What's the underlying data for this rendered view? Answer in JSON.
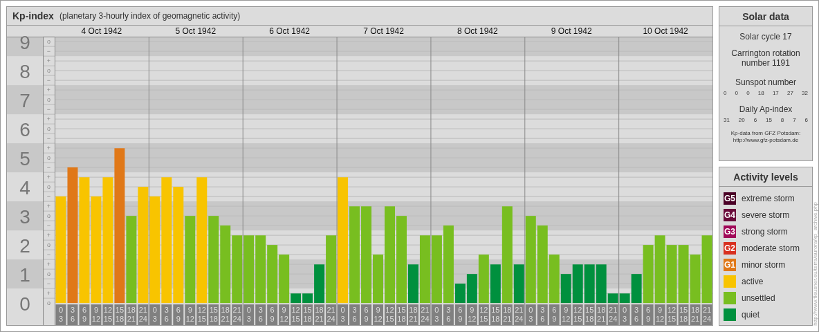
{
  "kp_panel": {
    "title": "Kp-index",
    "subtitle": "(planetary 3-hourly index of geomagnetic activity)",
    "days": [
      {
        "date": "4 Oct 1942"
      },
      {
        "date": "5 Oct 1942"
      },
      {
        "date": "6 Oct 1942"
      },
      {
        "date": "7 Oct 1942"
      },
      {
        "date": "8 Oct 1942"
      },
      {
        "date": "9 Oct 1942"
      },
      {
        "date": "10 Oct 1942"
      }
    ],
    "chart_data": {
      "type": "bar",
      "grid": true,
      "ylim": [
        0,
        9.17
      ],
      "yticks": [
        0,
        1,
        2,
        3,
        4,
        5,
        6,
        7,
        8,
        9
      ],
      "annotations": [
        "o",
        "+",
        "−",
        "o",
        "+",
        "−",
        "o",
        "+",
        "−",
        "o",
        "+",
        "−",
        "o",
        "+",
        "−",
        "o",
        "+",
        "−",
        "o",
        "+",
        "−",
        "o",
        "+",
        "−",
        "o",
        "+",
        "−",
        "o"
      ],
      "categories": [
        "0 3",
        "3 6",
        "6 9",
        "9 12",
        "12 15",
        "15 18",
        "18 21",
        "21 24",
        "0 3",
        "3 6",
        "6 9",
        "9 12",
        "12 15",
        "15 18",
        "18 21",
        "21 24",
        "0 3",
        "3 6",
        "6 9",
        "9 12",
        "12 15",
        "15 18",
        "18 21",
        "21 24",
        "0 3",
        "3 6",
        "6 9",
        "9 12",
        "12 15",
        "15 18",
        "18 21",
        "21 24",
        "0 3",
        "3 6",
        "6 9",
        "9 12",
        "12 15",
        "15 18",
        "18 21",
        "21 24",
        "0 3",
        "3 6",
        "6 9",
        "9 12",
        "12 15",
        "15 18",
        "18 21",
        "21 24",
        "0 3",
        "3 6",
        "6 9",
        "9 12",
        "12 15",
        "15 18",
        "18 21",
        "21 24"
      ],
      "values": [
        3.67,
        4.67,
        4.33,
        3.67,
        4.33,
        5.33,
        3,
        4,
        3.67,
        4.33,
        4,
        3,
        4.33,
        3,
        2.67,
        2.33,
        2.33,
        2.33,
        2,
        1.67,
        0.33,
        0.33,
        1.33,
        2.33,
        4.33,
        3.33,
        3.33,
        1.67,
        3.33,
        3,
        1.33,
        2.33,
        2.33,
        2.67,
        0.67,
        1,
        1.67,
        1.33,
        3.33,
        1.33,
        3,
        2.67,
        1.67,
        1,
        1.33,
        1.33,
        1.33,
        0.33,
        0.33,
        1,
        2,
        2.33,
        2,
        2,
        1.67,
        2.33
      ]
    }
  },
  "solar_data": {
    "title": "Solar data",
    "cycle": "Solar cycle 17",
    "rotation": "Carrington rotation number 1191",
    "sunspot_label": "Sunspot number",
    "sunspot_values": [
      "0",
      "0",
      "0",
      "18",
      "17",
      "27",
      "32"
    ],
    "ap_label": "Daily Ap-index",
    "ap_values": [
      "31",
      "20",
      "6",
      "15",
      "8",
      "7",
      "6"
    ],
    "source": "Kp-data from GFZ Potsdam:",
    "source_url": "http://www.gfz-potsdam.de"
  },
  "activity_levels": {
    "title": "Activity levels",
    "items": [
      {
        "badge": "G5",
        "label": "extreme storm",
        "color": "#4a0026"
      },
      {
        "badge": "G4",
        "label": "severe storm",
        "color": "#6a0a3a"
      },
      {
        "badge": "G3",
        "label": "strong storm",
        "color": "#a00858"
      },
      {
        "badge": "G2",
        "label": "moderate storm",
        "color": "#d83020"
      },
      {
        "badge": "G1",
        "label": "minor storm",
        "color": "#e07818"
      },
      {
        "label": "active",
        "color": "#f8c400"
      },
      {
        "label": "unsettled",
        "color": "#78be20"
      },
      {
        "label": "quiet",
        "color": "#00903e"
      }
    ]
  },
  "credit": "http://www.fleusner.eu/terra/aurora/kp_archive.php"
}
